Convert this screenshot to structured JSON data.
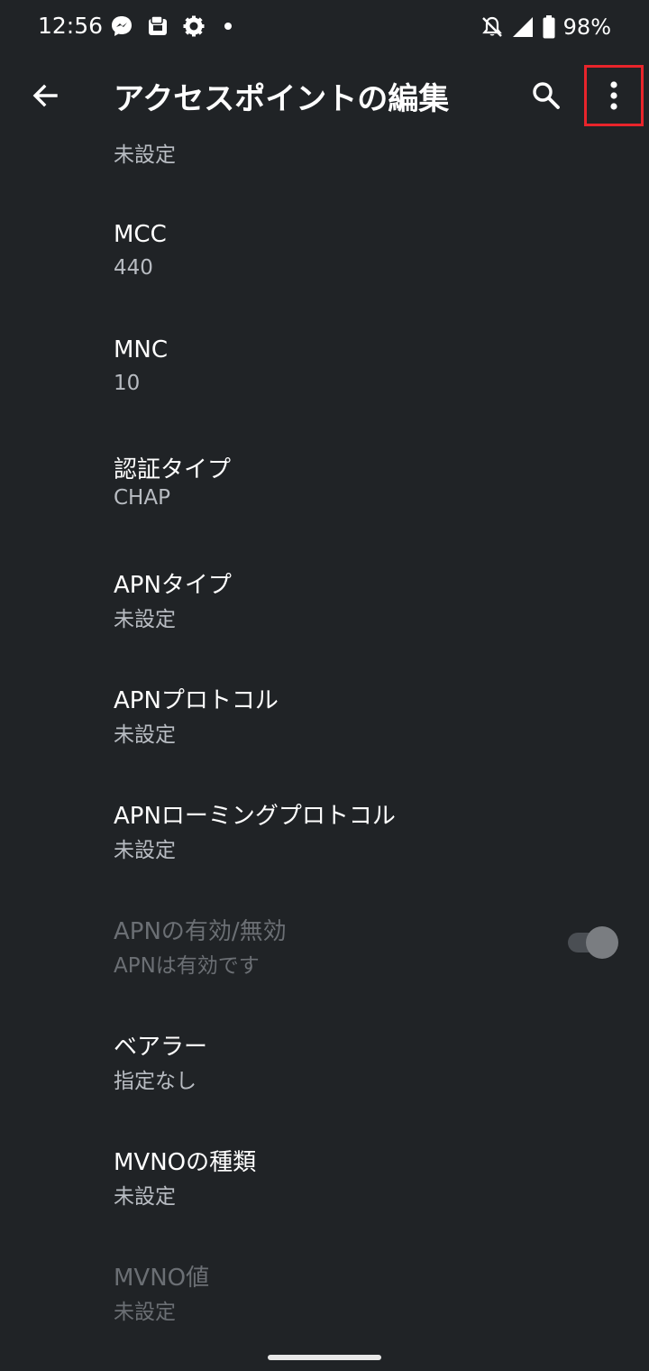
{
  "status_bar": {
    "time": "12:56",
    "battery": "98%",
    "icons": [
      "messenger-icon",
      "wallet-icon",
      "gear-icon",
      "dot-icon",
      "bell-off-icon",
      "signal-icon",
      "battery-icon"
    ]
  },
  "app_bar": {
    "title": "アクセスポイントの編集",
    "back_icon": "arrow-back-icon",
    "search_icon": "search-icon",
    "more_icon": "more-vert-icon"
  },
  "partial_top_summary": "未設定",
  "items": [
    {
      "title": "MCC",
      "summary": "440",
      "disabled": false
    },
    {
      "title": "MNC",
      "summary": "10",
      "disabled": false
    },
    {
      "title": "認証タイプ",
      "summary": "CHAP",
      "disabled": false
    },
    {
      "title": "APNタイプ",
      "summary": "未設定",
      "disabled": false
    },
    {
      "title": "APNプロトコル",
      "summary": "未設定",
      "disabled": false
    },
    {
      "title": "APNローミングプロトコル",
      "summary": "未設定",
      "disabled": false
    },
    {
      "title": "APNの有効/無効",
      "summary": "APNは有効です",
      "disabled": true,
      "switch_on": true
    },
    {
      "title": "ベアラー",
      "summary": "指定なし",
      "disabled": false
    },
    {
      "title": "MVNOの種類",
      "summary": "未設定",
      "disabled": false
    },
    {
      "title": "MVNO値",
      "summary": "未設定",
      "disabled": true
    }
  ],
  "colors": {
    "background": "#202326",
    "highlight_box": "#e8242b"
  }
}
